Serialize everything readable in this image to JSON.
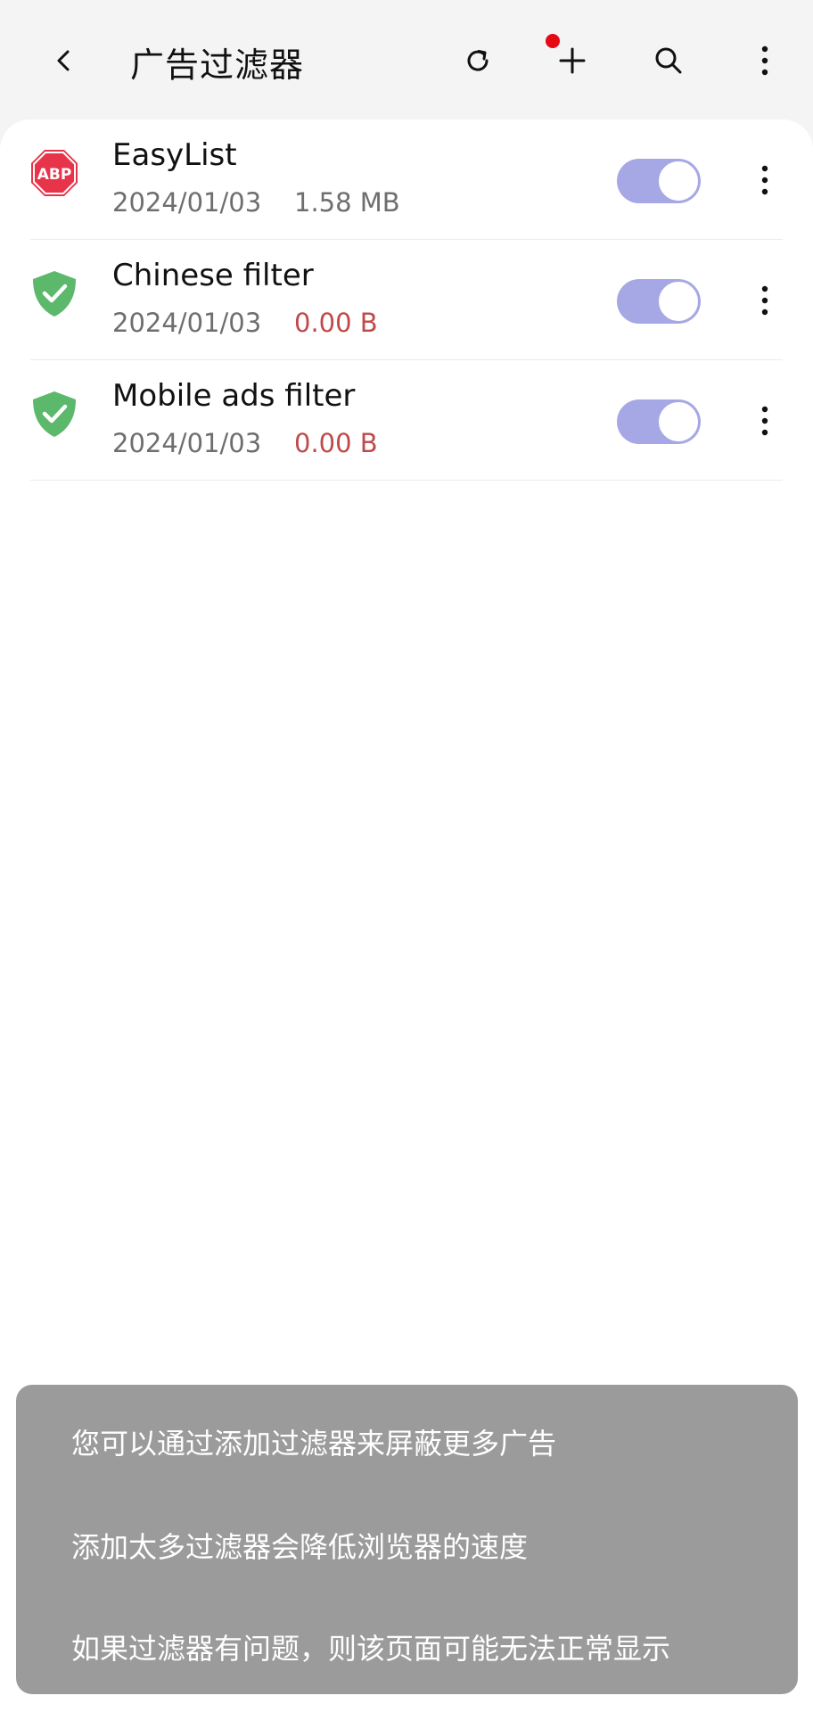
{
  "header": {
    "title": "广告过滤器",
    "icons": [
      "back-icon",
      "refresh-icon",
      "add-icon",
      "search-icon",
      "more-vertical-icon"
    ],
    "badge_color": "#e50914"
  },
  "filters": [
    {
      "name": "EasyList",
      "date": "2024/01/03",
      "size": "1.58 MB",
      "icon": "abp-icon",
      "enabled": true
    },
    {
      "name": "Chinese filter",
      "date": "2024/01/03",
      "size": "0.00 B",
      "icon": "shield-check-icon",
      "enabled": true
    },
    {
      "name": "Mobile ads filter",
      "date": "2024/01/03",
      "size": "0.00 B",
      "icon": "shield-check-icon",
      "enabled": true
    }
  ],
  "tooltip": {
    "lines": [
      "您可以通过添加过滤器来屏蔽更多广告",
      "添加太多过滤器会降低浏览器的速度",
      "如果过滤器有问题，则该页面可能无法正常显示"
    ]
  },
  "colors": {
    "toggle_on": "#a6a8e6",
    "zero_size": "#c0494a",
    "abp_red": "#e8344a",
    "shield_green": "#5cb86b"
  }
}
